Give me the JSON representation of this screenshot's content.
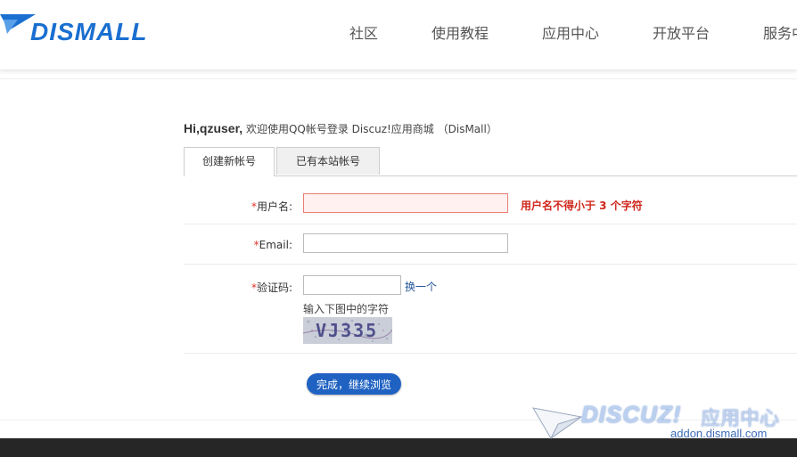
{
  "header": {
    "logo_text": "DISMALL",
    "nav": [
      "社区",
      "使用教程",
      "应用中心",
      "开放平台",
      "服务中"
    ]
  },
  "greeting": {
    "user": "Hi,qzuser,",
    "message": " 欢迎使用QQ帐号登录 Discuz!应用商城 （DisMall）"
  },
  "tabs": [
    {
      "label": "创建新帐号",
      "active": true
    },
    {
      "label": "已有本站帐号",
      "active": false
    }
  ],
  "form": {
    "username": {
      "label": "用户名:",
      "required_mark": "*",
      "value": "",
      "error": "用户名不得小于 3 个字符"
    },
    "email": {
      "label": "Email:",
      "required_mark": "*",
      "value": ""
    },
    "captcha": {
      "label": "验证码:",
      "required_mark": "*",
      "value": "",
      "refresh_link": "换一个",
      "hint": "输入下图中的字符",
      "image_text": "VJ335"
    },
    "submit_label": "完成，继续浏览"
  },
  "watermark": {
    "brand": "DISCUZ!",
    "cn": "应用中心",
    "url": "addon.dismall.com"
  },
  "colors": {
    "brand_blue": "#1a6fd0",
    "error_red": "#d0261b",
    "button_blue": "#1f62c2",
    "footer_dark": "#262626"
  }
}
